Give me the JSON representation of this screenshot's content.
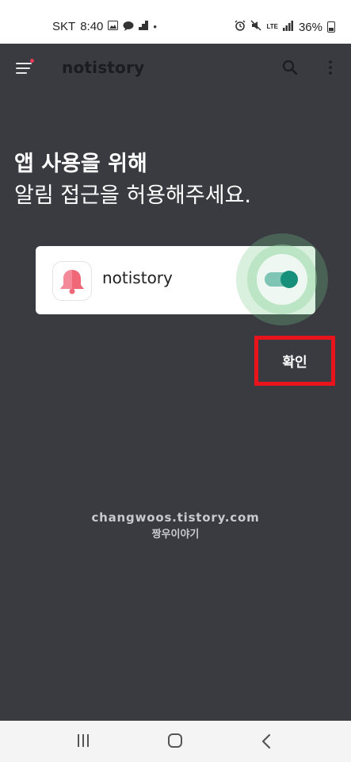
{
  "status_bar": {
    "carrier": "SKT",
    "time": "8:40",
    "network": "LTE",
    "battery": "36%",
    "icons_left": [
      "image-icon",
      "chat-icon",
      "signal-bars-small-icon",
      "dot-icon"
    ],
    "icons_right": [
      "alarm-icon",
      "mute-icon",
      "lte-icon",
      "signal-icon",
      "battery-icon"
    ]
  },
  "app_bar": {
    "title": "notistory",
    "icons": [
      "menu-icon",
      "search-icon",
      "more-vert-icon"
    ]
  },
  "main": {
    "heading_line1": "앱 사용을 위해",
    "heading_line2": "알림 접근을 허용해주세요.",
    "card": {
      "app_name": "notistory",
      "toggle_state": "on"
    },
    "confirm_label": "확인"
  },
  "watermark": {
    "line1": "changwoos.tistory.com",
    "line2": "짱우이야기"
  },
  "nav_bar": {
    "icons": [
      "recent-apps-icon",
      "home-icon",
      "back-icon"
    ]
  },
  "colors": {
    "background": "#3a3a41",
    "toggle_track": "#7fc5b5",
    "toggle_knob": "#16907a",
    "highlight": "#e8131b",
    "bell": "#f06878"
  }
}
